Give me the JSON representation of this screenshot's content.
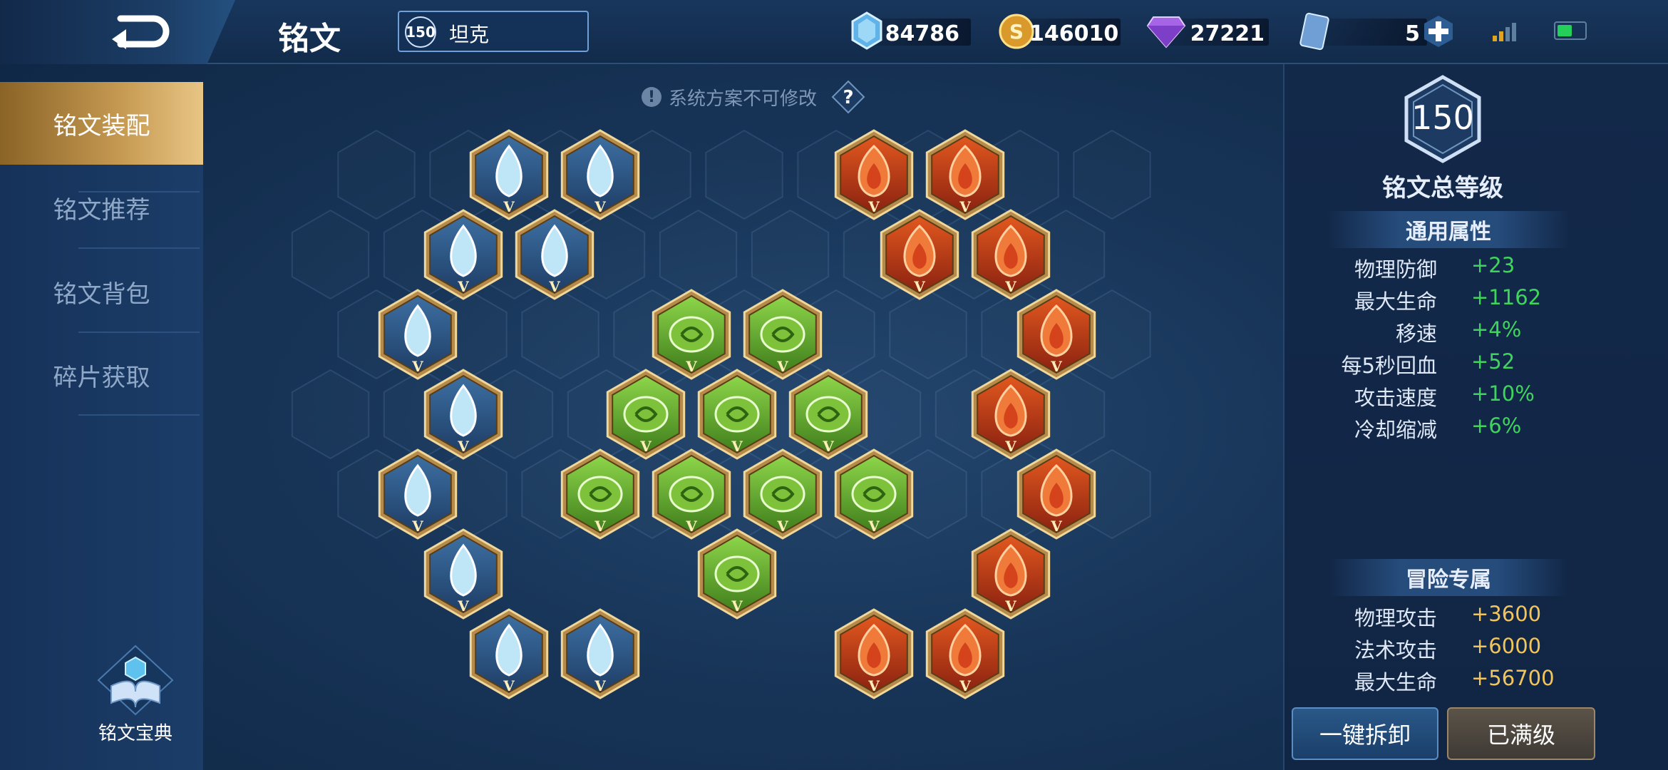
{
  "header": {
    "title": "铭文",
    "hero": {
      "level": "150",
      "name": "坦克"
    },
    "currencies": [
      {
        "icon": "crystal-icon",
        "value": "84786"
      },
      {
        "icon": "gold-coin-icon",
        "value": "146010"
      },
      {
        "icon": "diamond-icon",
        "value": "27221"
      },
      {
        "icon": "card-icon",
        "value": "5"
      }
    ],
    "battery_level": 0.55
  },
  "sidebar": {
    "items": [
      {
        "label": "铭文装配",
        "active": true
      },
      {
        "label": "铭文推荐",
        "active": false
      },
      {
        "label": "铭文背包",
        "active": false
      },
      {
        "label": "碎片获取",
        "active": false
      }
    ],
    "codex_label": "铭文宝典"
  },
  "main": {
    "notice": "系统方案不可修改",
    "help": "?",
    "rune_groups": {
      "blue": {
        "name": "blue-rune",
        "color": "#bfe6f7",
        "count": 10
      },
      "green": {
        "name": "green-rune",
        "color": "#7dc23a",
        "count": 10
      },
      "red": {
        "name": "red-rune",
        "color": "#d4431b",
        "count": 10
      }
    },
    "rune_rank": "V"
  },
  "right_panel": {
    "level": "150",
    "total_label": "铭文总等级",
    "general_title": "通用属性",
    "general_stats": [
      {
        "name": "物理防御",
        "value": "+23"
      },
      {
        "name": "最大生命",
        "value": "+1162"
      },
      {
        "name": "移速",
        "value": "+4%"
      },
      {
        "name": "每5秒回血",
        "value": "+52"
      },
      {
        "name": "攻击速度",
        "value": "+10%"
      },
      {
        "name": "冷却缩减",
        "value": "+6%"
      }
    ],
    "adventure_title": "冒险专属",
    "adventure_stats": [
      {
        "name": "物理攻击",
        "value": "+3600"
      },
      {
        "name": "法术攻击",
        "value": "+6000"
      },
      {
        "name": "最大生命",
        "value": "+56700"
      }
    ],
    "unequip_label": "一键拆卸",
    "maxed_label": "已满级"
  }
}
